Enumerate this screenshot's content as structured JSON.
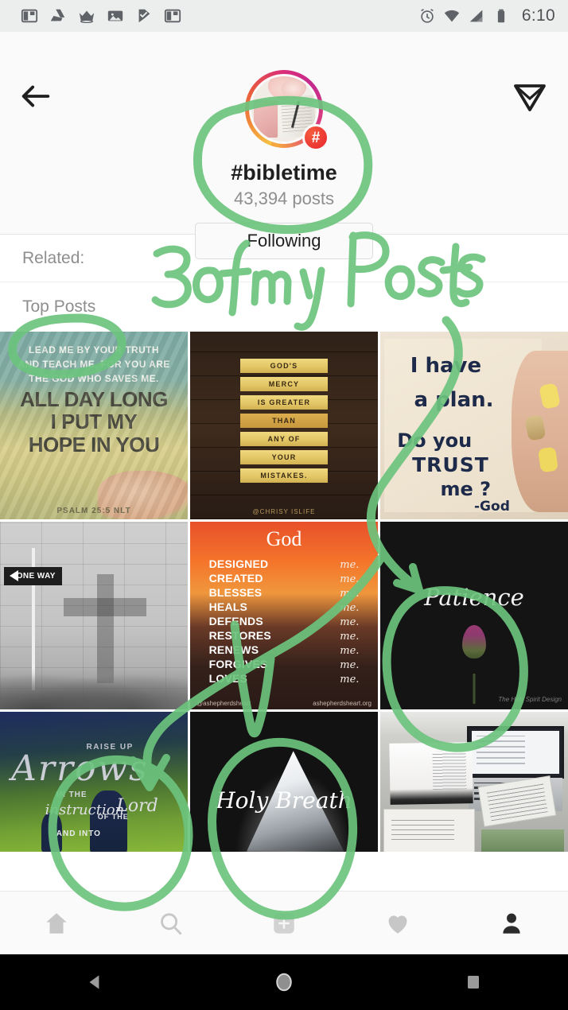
{
  "statusbar": {
    "time": "6:10",
    "left_icons": [
      "split-panel-icon",
      "google-drive-icon",
      "crown-icon",
      "photo-icon",
      "check-flag-icon",
      "split-panel-icon"
    ],
    "right_icons": [
      "alarm-icon",
      "wifi-icon",
      "signal-icon",
      "battery-icon"
    ]
  },
  "header": {
    "back_icon": "back-arrow-icon",
    "send_icon": "send-paper-plane-icon",
    "badge": "#",
    "hashtag": "#bibletime",
    "post_count": "43,394 posts",
    "follow_button": "Following"
  },
  "related": {
    "label": "Related:"
  },
  "section": {
    "top_posts_label": "Top Posts"
  },
  "posts": [
    {
      "name": "psalm-hope-post",
      "lines": [
        "LEAD ME BY YOUR TRUTH",
        "AND TEACH ME, FOR YOU ARE",
        "THE GOD WHO SAVES ME."
      ],
      "headline": "ALL DAY LONG\nI PUT MY\nHOPE IN YOU",
      "credit": "PSALM 25:5 NLT"
    },
    {
      "name": "gods-mercy-post",
      "plaques": [
        "GOD'S",
        "MERCY",
        "IS GREATER",
        "THAN",
        "ANY OF",
        "YOUR",
        "MISTAKES."
      ],
      "credit": "@CHRISY ISLIFE"
    },
    {
      "name": "i-have-a-plan-post",
      "lines": [
        "I have",
        "a plan.",
        "Do you",
        "TRUST",
        "me ?",
        "-God"
      ]
    },
    {
      "name": "one-way-cross-post",
      "sign_text": "ONE WAY"
    },
    {
      "name": "god-designed-me-post",
      "title": "God",
      "rows": [
        {
          "verb": "DESIGNED",
          "obj": "me."
        },
        {
          "verb": "CREATED",
          "obj": "me."
        },
        {
          "verb": "BLESSES",
          "obj": "me."
        },
        {
          "verb": "HEALS",
          "obj": "me."
        },
        {
          "verb": "DEFENDS",
          "obj": "me."
        },
        {
          "verb": "RESTORES",
          "obj": "me."
        },
        {
          "verb": "RENEWS",
          "obj": "me."
        },
        {
          "verb": "FORGIVES",
          "obj": "me."
        },
        {
          "verb": "LOVES",
          "obj": "me."
        }
      ],
      "handle": "@ashepherdsheart",
      "site": "ashepherdsheart.org"
    },
    {
      "name": "patience-post",
      "word": "Patience",
      "signature": "The Holy Spirit Design"
    },
    {
      "name": "raise-up-arrows-post",
      "raise_up": "RAISE UP",
      "arrows": "Arrows",
      "in_the": "IN THE",
      "instruction": "instruction",
      "of_the": "OF THE",
      "lord": "Lord",
      "and_into": "AND INTO"
    },
    {
      "name": "holy-breath-post",
      "word": "Holy Breath"
    },
    {
      "name": "bible-study-desk-post"
    }
  ],
  "bottom_nav": [
    {
      "name": "nav-home",
      "icon": "home-icon",
      "active": false
    },
    {
      "name": "nav-search",
      "icon": "search-icon",
      "active": false
    },
    {
      "name": "nav-add",
      "icon": "plus-square-icon",
      "active": false
    },
    {
      "name": "nav-activity",
      "icon": "heart-icon",
      "active": false
    },
    {
      "name": "nav-profile",
      "icon": "person-icon",
      "active": true
    }
  ],
  "android_nav": [
    {
      "name": "android-back",
      "icon": "triangle-back-icon"
    },
    {
      "name": "android-home",
      "icon": "circle-home-icon"
    },
    {
      "name": "android-recents",
      "icon": "square-recents-icon"
    }
  ],
  "annotations": {
    "color": "#6cc47e",
    "handwritten_note": "3 of my Posts",
    "circled_items": [
      "hashtag-name",
      "top-posts-label",
      "patience-post",
      "raise-up-arrows-post",
      "holy-breath-post"
    ],
    "arrows": [
      "arrow-to-patience-post",
      "arrow-to-arrows-post"
    ]
  }
}
